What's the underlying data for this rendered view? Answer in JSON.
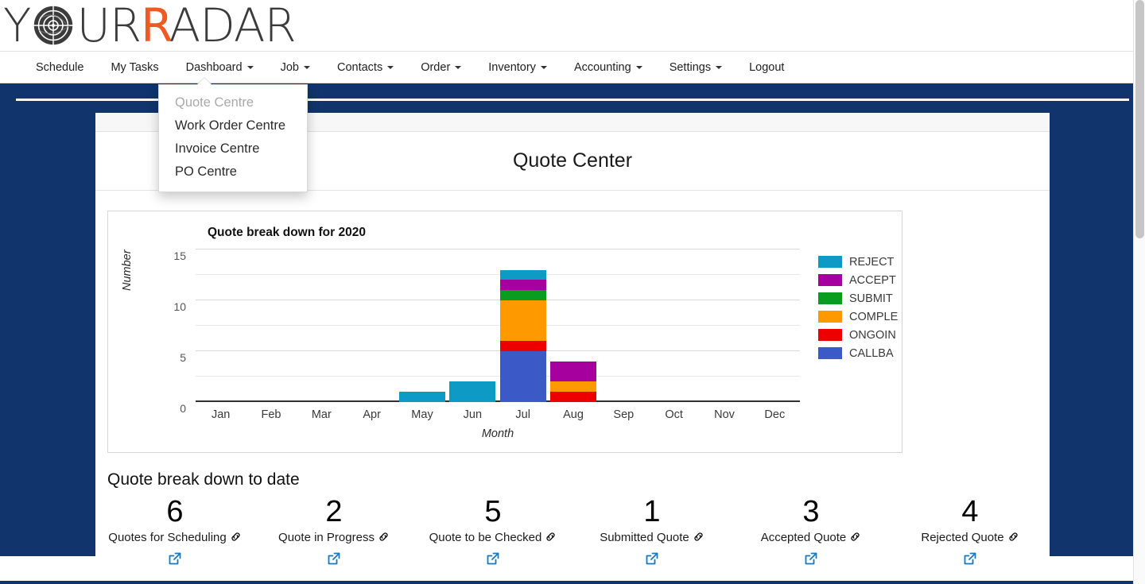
{
  "brand": {
    "text_before": "Y",
    "radar_icon": "radar-target-icon",
    "text_mid": "UR",
    "accent_letter": "R",
    "text_after": "ADAR",
    "full_name": "YOURADAR",
    "accent_color": "#f05a22"
  },
  "nav": {
    "items": [
      {
        "label": "Schedule",
        "has_caret": false
      },
      {
        "label": "My Tasks",
        "has_caret": false
      },
      {
        "label": "Dashboard",
        "has_caret": true
      },
      {
        "label": "Job",
        "has_caret": true
      },
      {
        "label": "Contacts",
        "has_caret": true
      },
      {
        "label": "Order",
        "has_caret": true
      },
      {
        "label": "Inventory",
        "has_caret": true
      },
      {
        "label": "Accounting",
        "has_caret": true
      },
      {
        "label": "Settings",
        "has_caret": true
      },
      {
        "label": "Logout",
        "has_caret": false
      }
    ]
  },
  "dropdown": {
    "open_for": "Dashboard",
    "items": [
      {
        "label": "Quote Centre",
        "disabled": true
      },
      {
        "label": "Work Order Centre",
        "disabled": false
      },
      {
        "label": "Invoice Centre",
        "disabled": false
      },
      {
        "label": "PO Centre",
        "disabled": false
      }
    ]
  },
  "page": {
    "title": "Quote Center",
    "band_color": "#10346b"
  },
  "stats": {
    "heading": "Quote break down to date",
    "items": [
      {
        "value": "6",
        "label": "Quotes for Scheduling"
      },
      {
        "value": "2",
        "label": "Quote in Progress"
      },
      {
        "value": "5",
        "label": "Quote to be Checked"
      },
      {
        "value": "1",
        "label": "Submitted Quote"
      },
      {
        "value": "3",
        "label": "Accepted Quote"
      },
      {
        "value": "4",
        "label": "Rejected Quote"
      }
    ],
    "link_icon": "chain-link-icon",
    "open_icon": "external-link-icon",
    "open_icon_color": "#1878c2"
  },
  "chart_data": {
    "type": "bar",
    "stacked": true,
    "title": "Quote break down for 2020",
    "xlabel": "Month",
    "ylabel": "Number",
    "ylim": [
      0,
      15
    ],
    "yticks": [
      0,
      5,
      10,
      15
    ],
    "minor_gridlines": [
      2.5,
      7.5,
      12.5
    ],
    "grid": true,
    "legend_position": "right",
    "categories": [
      "Jan",
      "Feb",
      "Mar",
      "Apr",
      "May",
      "Jun",
      "Jul",
      "Aug",
      "Sep",
      "Oct",
      "Nov",
      "Dec"
    ],
    "series": [
      {
        "name": "CALLBA",
        "color": "#3b5ac8",
        "values": [
          0,
          0,
          0,
          0,
          0,
          0,
          5,
          0,
          0,
          0,
          0,
          0
        ]
      },
      {
        "name": "ONGOIN",
        "color": "#ed0000",
        "values": [
          0,
          0,
          0,
          0,
          0,
          0,
          1,
          1,
          0,
          0,
          0,
          0
        ]
      },
      {
        "name": "COMPLE",
        "color": "#ff9900",
        "values": [
          0,
          0,
          0,
          0,
          0,
          0,
          4,
          1,
          0,
          0,
          0,
          0
        ]
      },
      {
        "name": "SUBMIT",
        "color": "#0a9c1e",
        "values": [
          0,
          0,
          0,
          0,
          0,
          0,
          1,
          0,
          0,
          0,
          0,
          0
        ]
      },
      {
        "name": "ACCEPT",
        "color": "#a6009e",
        "values": [
          0,
          0,
          0,
          0,
          0,
          0,
          1,
          2,
          0,
          0,
          0,
          0
        ]
      },
      {
        "name": "REJECT",
        "color": "#0d9bc6",
        "values": [
          0,
          0,
          0,
          0,
          1,
          2,
          1,
          0,
          0,
          0,
          0,
          0
        ]
      }
    ],
    "legend_order_top_to_bottom": [
      "REJECT",
      "ACCEPT",
      "SUBMIT",
      "COMPLE",
      "ONGOIN",
      "CALLBA"
    ],
    "totals": [
      0,
      0,
      0,
      0,
      1,
      2,
      13,
      4,
      0,
      0,
      0,
      0
    ]
  }
}
